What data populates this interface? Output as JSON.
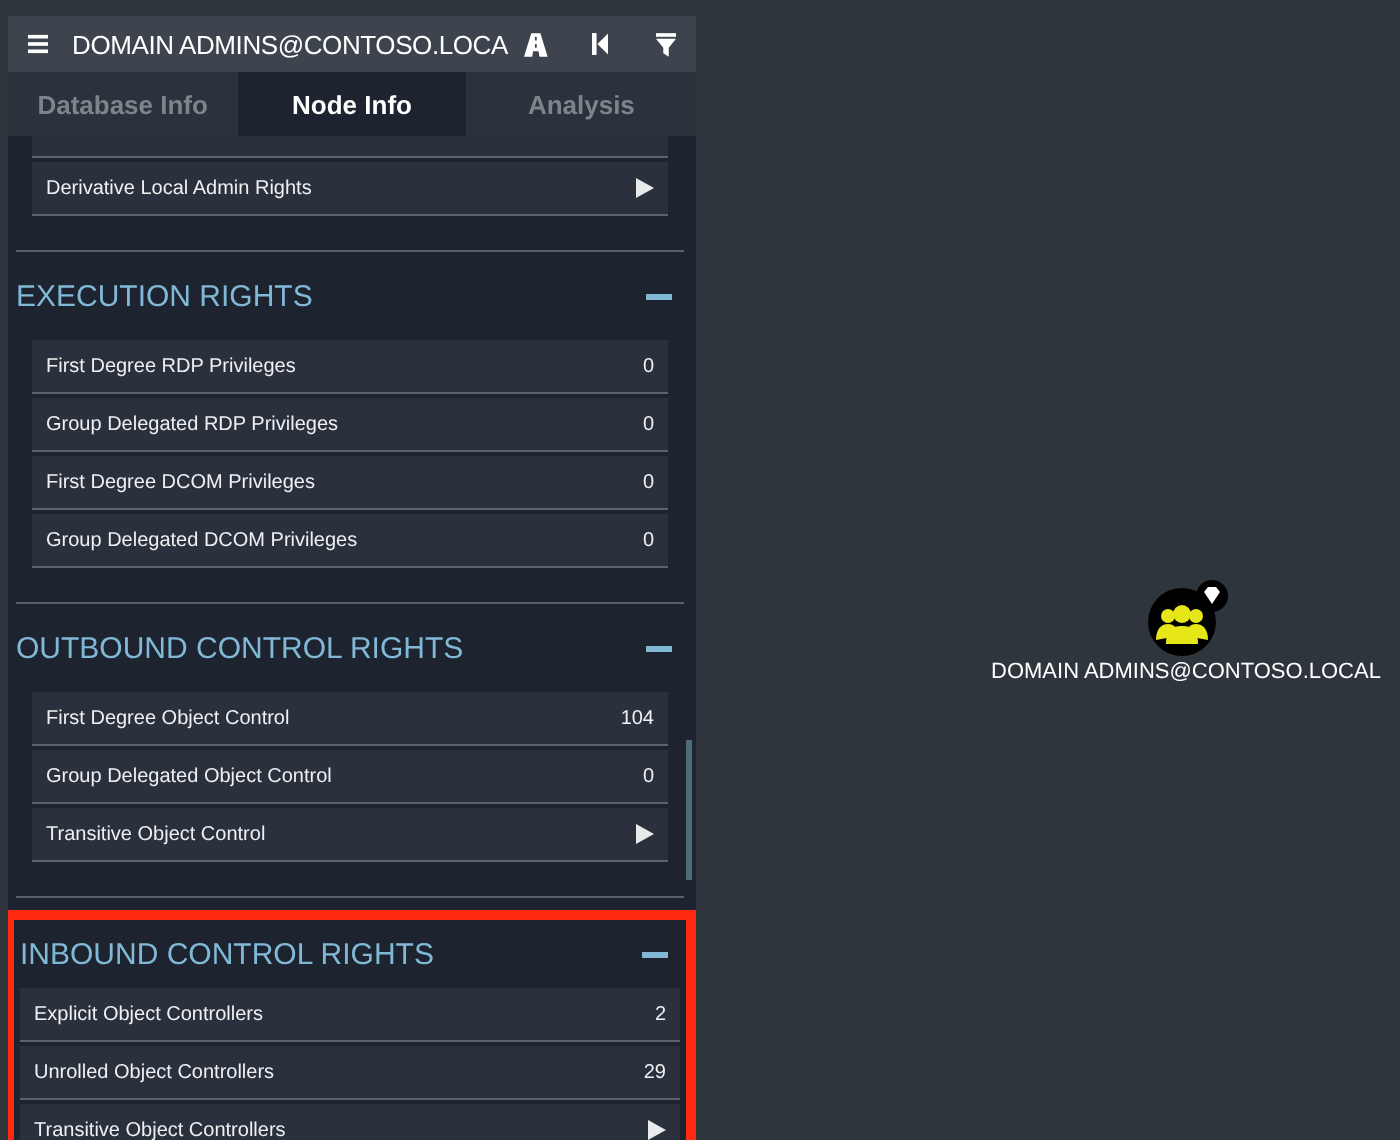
{
  "header": {
    "title": "DOMAIN ADMINS@CONTOSO.LOCA"
  },
  "tabs": [
    {
      "label": "Database Info",
      "selected": false
    },
    {
      "label": "Node Info",
      "selected": true
    },
    {
      "label": "Analysis",
      "selected": false
    }
  ],
  "sections": [
    {
      "rows": [
        {
          "kind": "expand",
          "label": "Derivative Local Admin Rights"
        }
      ]
    },
    {
      "title": "EXECUTION RIGHTS",
      "expanded": true,
      "highlighted": false,
      "rows": [
        {
          "kind": "count",
          "label": "First Degree RDP Privileges",
          "value": "0"
        },
        {
          "kind": "count",
          "label": "Group Delegated RDP Privileges",
          "value": "0"
        },
        {
          "kind": "count",
          "label": "First Degree DCOM Privileges",
          "value": "0"
        },
        {
          "kind": "count",
          "label": "Group Delegated DCOM Privileges",
          "value": "0"
        }
      ]
    },
    {
      "title": "OUTBOUND CONTROL RIGHTS",
      "expanded": true,
      "highlighted": false,
      "rows": [
        {
          "kind": "count",
          "label": "First Degree Object Control",
          "value": "104"
        },
        {
          "kind": "count",
          "label": "Group Delegated Object Control",
          "value": "0"
        },
        {
          "kind": "expand",
          "label": "Transitive Object Control"
        }
      ]
    },
    {
      "title": "INBOUND CONTROL RIGHTS",
      "expanded": true,
      "highlighted": true,
      "rows": [
        {
          "kind": "count",
          "label": "Explicit Object Controllers",
          "value": "2"
        },
        {
          "kind": "count",
          "label": "Unrolled Object Controllers",
          "value": "29"
        },
        {
          "kind": "expand",
          "label": "Transitive Object Controllers"
        }
      ]
    }
  ],
  "node": {
    "label": "DOMAIN ADMINS@CONTOSO.LOCAL",
    "high_value": true
  }
}
